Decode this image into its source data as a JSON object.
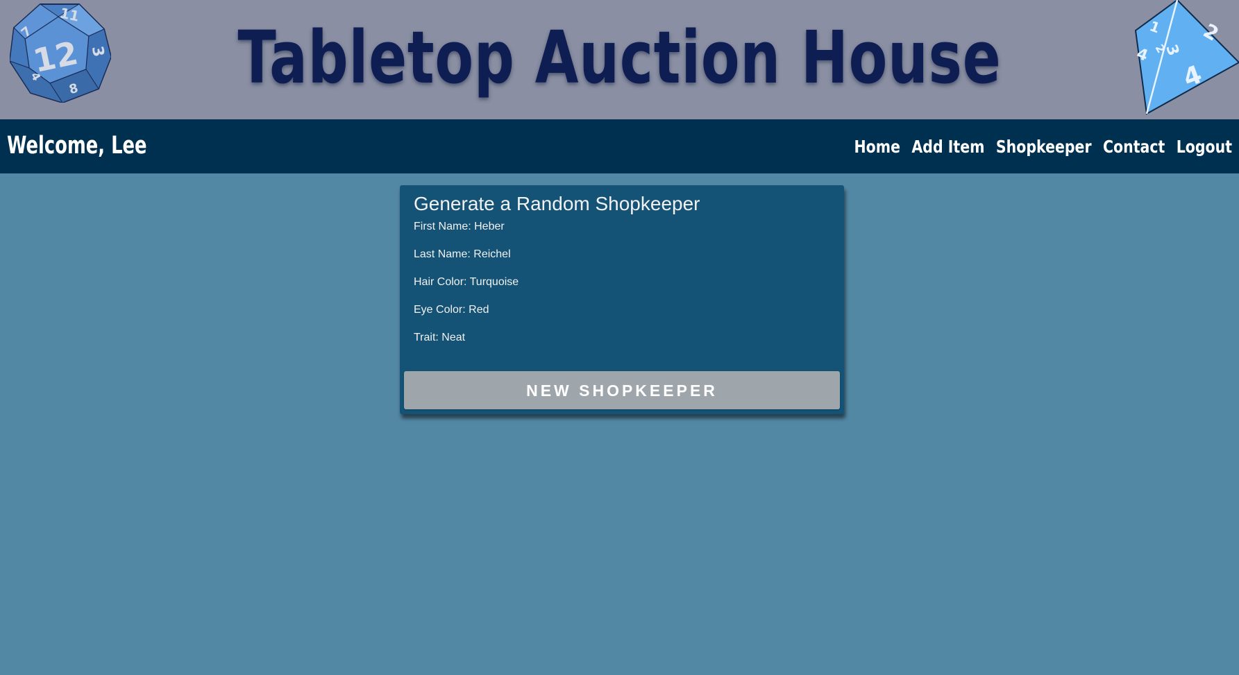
{
  "header": {
    "site_title": "Tabletop Auction House",
    "left_die_icon": "d12-die-icon",
    "right_die_icon": "d4-die-icon"
  },
  "nav": {
    "welcome": "Welcome, Lee",
    "links": [
      {
        "label": "Home"
      },
      {
        "label": "Add Item"
      },
      {
        "label": "Shopkeeper"
      },
      {
        "label": "Contact"
      },
      {
        "label": "Logout"
      }
    ]
  },
  "card": {
    "title": "Generate a Random Shopkeeper",
    "fields": [
      "First Name: Heber",
      "Last Name: Reichel",
      "Hair Color: Turquoise",
      "Eye Color: Red",
      "Trait: Neat"
    ],
    "button_label": "NEW SHOPKEEPER"
  },
  "colors": {
    "page_bg": "#5388a5",
    "banner_bg": "#8a8fa3",
    "title_color": "#0e1d52",
    "navbar_bg": "#00304f",
    "card_bg": "#145376",
    "button_bg": "#9ea6ab"
  }
}
